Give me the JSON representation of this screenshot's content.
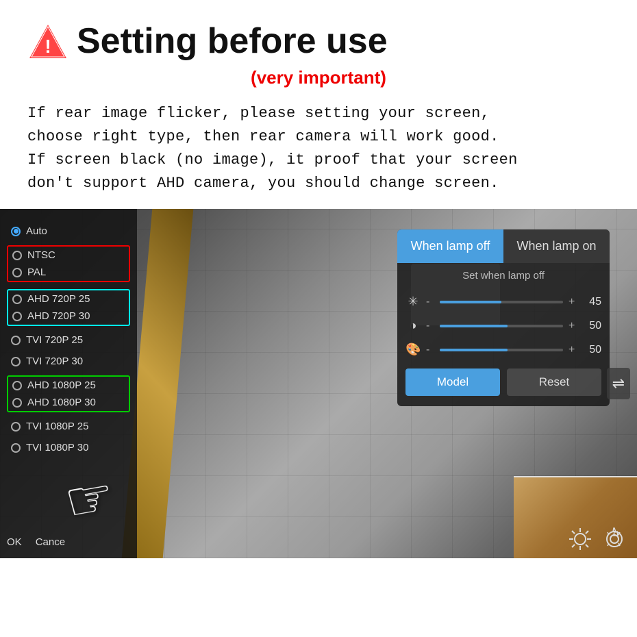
{
  "page": {
    "title": "Setting before use",
    "subtitle": "(very important)",
    "warning_icon": "⚠",
    "description_lines": [
      "If rear image flicker, please setting your screen,",
      "choose right type, then rear camera will work good.",
      "If screen black (no image), it proof that your screen",
      "don't support AHD camera, you should change screen."
    ]
  },
  "menu": {
    "items": [
      {
        "label": "Auto",
        "selected": true
      },
      {
        "label": "NTSC",
        "selected": false,
        "group": "red"
      },
      {
        "label": "PAL",
        "selected": false,
        "group": "red"
      },
      {
        "label": "AHD 720P 25",
        "selected": false,
        "group": "cyan"
      },
      {
        "label": "AHD 720P 30",
        "selected": false,
        "group": "cyan"
      },
      {
        "label": "TVI 720P 25",
        "selected": false
      },
      {
        "label": "TVI 720P 30",
        "selected": false
      },
      {
        "label": "AHD 1080P 25",
        "selected": false,
        "group": "green"
      },
      {
        "label": "AHD 1080P 30",
        "selected": false,
        "group": "green"
      },
      {
        "label": "TVI 1080P 25",
        "selected": false
      },
      {
        "label": "TVI 1080P 30",
        "selected": false
      }
    ],
    "footer": {
      "ok": "OK",
      "cancel": "Cance"
    }
  },
  "settings_panel": {
    "tabs": [
      {
        "label": "When lamp off",
        "active": true
      },
      {
        "label": "When lamp on",
        "active": false
      }
    ],
    "section_title": "Set when lamp off",
    "sliders": [
      {
        "icon": "☀",
        "min": "-",
        "max": "+",
        "value": 45,
        "fill_pct": 50
      },
      {
        "icon": "◑",
        "min": "-",
        "max": "+",
        "value": 50,
        "fill_pct": 55
      },
      {
        "icon": "🎨",
        "min": "-",
        "max": "+",
        "value": 50,
        "fill_pct": 55
      }
    ],
    "buttons": [
      {
        "label": "Model",
        "style": "primary"
      },
      {
        "label": "Reset",
        "style": "secondary"
      }
    ]
  },
  "colors": {
    "accent_blue": "#4a9fdf",
    "accent_red": "#cc0000",
    "accent_cyan": "#00dddd",
    "accent_green": "#00cc00",
    "tab_active_bg": "#4a9fdf",
    "tab_inactive_bg": "#555555"
  }
}
